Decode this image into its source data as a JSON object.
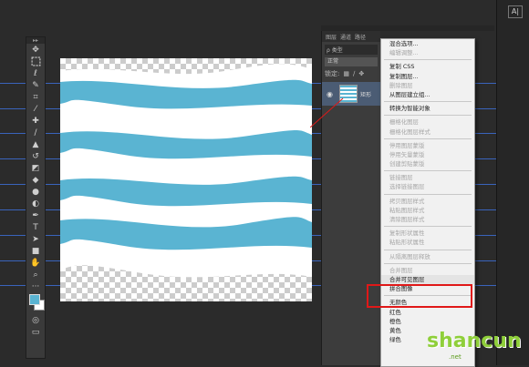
{
  "layers_panel": {
    "tabs": [
      "图层",
      "通道",
      "路径"
    ],
    "kind_filter": "ρ 类型",
    "blend_mode": "正常",
    "lock_label": "锁定:",
    "layer_name": "矩形"
  },
  "context_menu": {
    "items": [
      {
        "label": "混合选项...",
        "disabled": false
      },
      {
        "label": "编辑调整...",
        "disabled": true
      },
      {
        "sep": true
      },
      {
        "label": "复制 CSS",
        "disabled": false
      },
      {
        "label": "复制图层...",
        "disabled": false
      },
      {
        "label": "删除图层",
        "disabled": true
      },
      {
        "label": "从图层建立组...",
        "disabled": false
      },
      {
        "sep": true
      },
      {
        "label": "转换为智能对象",
        "disabled": false
      },
      {
        "sep": true
      },
      {
        "label": "栅格化图层",
        "disabled": true
      },
      {
        "label": "栅格化图层样式",
        "disabled": true
      },
      {
        "sep": true
      },
      {
        "label": "停用图层蒙版",
        "disabled": true
      },
      {
        "label": "停用矢量蒙版",
        "disabled": true
      },
      {
        "label": "创建剪贴蒙版",
        "disabled": true
      },
      {
        "sep": true
      },
      {
        "label": "链接图层",
        "disabled": true
      },
      {
        "label": "选择链接图层",
        "disabled": true
      },
      {
        "sep": true
      },
      {
        "label": "拷贝图层样式",
        "disabled": true
      },
      {
        "label": "粘贴图层样式",
        "disabled": true
      },
      {
        "label": "清除图层样式",
        "disabled": true
      },
      {
        "sep": true
      },
      {
        "label": "复制形状属性",
        "disabled": true
      },
      {
        "label": "粘贴形状属性",
        "disabled": true
      },
      {
        "sep": true
      },
      {
        "label": "从隔离图层释放",
        "disabled": true
      },
      {
        "sep": true
      },
      {
        "label": "合并图层",
        "disabled": true
      },
      {
        "label": "合并可见图层",
        "disabled": false,
        "highlighted": true
      },
      {
        "label": "拼合图像",
        "disabled": false
      },
      {
        "sep": true
      },
      {
        "label": "无颜色",
        "disabled": false
      },
      {
        "label": "红色",
        "disabled": false
      },
      {
        "label": "橙色",
        "disabled": false
      },
      {
        "label": "黄色",
        "disabled": false
      },
      {
        "label": "绿色",
        "disabled": false
      }
    ]
  },
  "right_panel": {
    "icon_letter": "A|"
  },
  "watermark": {
    "main": "shancun",
    "sub": ".net"
  },
  "colors": {
    "wave_fill": "#5ab4d2",
    "guide": "#3d6fd6",
    "highlight_border": "#e01818",
    "foreground_swatch": "#5ab4d2",
    "background_swatch": "#ffffff"
  },
  "tools": [
    "move",
    "marquee",
    "lasso",
    "quick-select",
    "crop",
    "eyedropper",
    "healing",
    "brush",
    "clone-stamp",
    "history-brush",
    "eraser",
    "paint-bucket",
    "blur",
    "dodge",
    "pen",
    "type",
    "path-select",
    "rectangle",
    "hand",
    "zoom"
  ]
}
